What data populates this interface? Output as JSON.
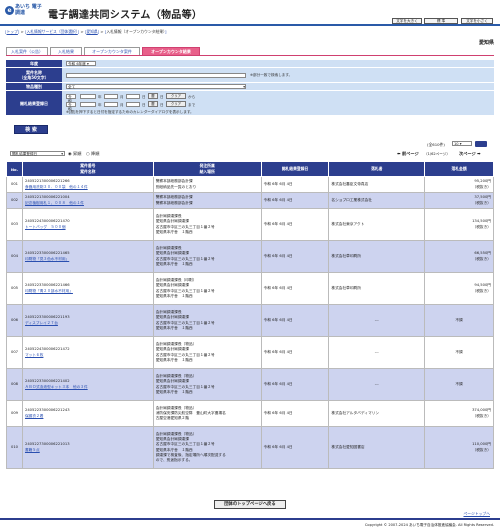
{
  "header": {
    "logo_mark": "e",
    "logo_text": "あいち 電子調達",
    "title": "電子調達共同システム（物品等）",
    "font_buttons": [
      "文字を大きく",
      "標 準",
      "文字を小さく"
    ]
  },
  "breadcrumb": {
    "items": [
      "トップ",
      "入札情報サービス（団体選択）",
      "愛知県",
      "入札情報（オープンカウンタ結果）"
    ],
    "sep": ">",
    "open": "[",
    "close": "]"
  },
  "prefecture": "愛知県",
  "tabs": [
    "入札案件（公告）",
    "入札結果",
    "オープンカウンタ案件",
    "オープンカウンタ結果"
  ],
  "search": {
    "year_label": "年度",
    "year_value": "令和 6年度",
    "name_label": "案件名称\n（全角50文字）",
    "name_note": "※部分一致で検索します。",
    "category_label": "物品種別",
    "category_value": "全て",
    "date_label": "開札結果登録日",
    "era": "令和",
    "unit_year": "年",
    "unit_month": "月",
    "unit_day": "日",
    "calendar_label": "暦",
    "from_label": "から",
    "to_label": "まで",
    "clear_label": "クリア",
    "cal_note": "※[暦]を押下すると日付を指定するためのカレンダーダイアログを表示します。",
    "search_button": "検 索"
  },
  "list": {
    "sort_value": "開札結果登録日",
    "asc_label": "昇順",
    "desc_label": "降順",
    "total": "(全610件)",
    "per_page": "10",
    "prev": "前ページ",
    "page_info": "（1/62ページ）",
    "next": "次ページ",
    "columns": [
      "No.",
      "案件番号\n案件名称",
      "発注所属\n納入場所",
      "開札結果登録日",
      "落札者",
      "落札金額"
    ],
    "rows": [
      {
        "no": "001",
        "num": "2405221300006221266",
        "name": "食器用洗剤３０．００袋　他の１４件",
        "org": "警察本部総務部会計課",
        "place": "別紙納品先一覧のとおり",
        "date": "令和 6年 6月 4日",
        "winner": "株式会社蕃臣文帝真店",
        "amount": "95,200円",
        "tax": "（税抜き）"
      },
      {
        "no": "002",
        "num": "2405221300006221004",
        "name": "記念植樹用札１，００８　他の１件",
        "org": "警察本部総務部会計課",
        "place": "警察本部総務部会計課",
        "date": "令和 6年 6月 4日",
        "winner": "名ショプロ工業株式会社",
        "amount": "37,500円",
        "tax": "（税抜き）"
      },
      {
        "no": "003",
        "num": "2405224300006221470",
        "name": "トートバッグ　５００個",
        "org": "会計局調達課長\n愛知県会計局調達課\n名古屋市中区三の丸三丁目１番２号\n愛知県本庁舎　１階西",
        "place": "",
        "date": "令和 6年 6月 4日",
        "winner": "株式会社東京アクト",
        "amount": "134,500円",
        "tax": "（税抜き）"
      },
      {
        "no": "004",
        "num": "2405223300006221465",
        "name": "印刷物「見３色水不材用」",
        "org": "会計局調達課長\n愛知県会計局調達課\n名古屋市中区三の丸三丁目１番２号\n愛知県本庁舎　１階西",
        "place": "",
        "date": "令和 6年 6月 4日",
        "winner": "株式会社草印刷所",
        "amount": "66,550円",
        "tax": "（税抜き）"
      },
      {
        "no": "005",
        "num": "2405223300006221466",
        "name": "印刷物「青２０部水不材用」",
        "org": "会計局調達課長（印刷）\n愛知県会計局調達課\n名古屋市中区三の丸三丁目１番２号\n愛知県本庁舎　１階西",
        "place": "",
        "date": "令和 6年 6月 4日",
        "winner": "株式会社草印刷所",
        "amount": "94,500円",
        "tax": "（税抜き）"
      },
      {
        "no": "006",
        "num": "2405223300006221193",
        "name": "ディスプレイ２７台",
        "org": "会計局調達課長\n愛知県会計局調達課\n名古屋市中区三の丸三丁目１番２号\n愛知県本庁舎　１階西",
        "place": "",
        "date": "令和 6年 6月 4日",
        "winner": "---",
        "amount": "不調",
        "tax": ""
      },
      {
        "no": "007",
        "num": "2405224300006221472",
        "name": "マット６枚",
        "org": "会計局調達課長（物品）\n愛知県会計局調達課\n名古屋市中区三の丸三丁目１番２号\n愛知県本庁舎　１階西",
        "place": "",
        "date": "令和 6年 6月 4日",
        "winner": "---",
        "amount": "不調",
        "tax": ""
      },
      {
        "no": "008",
        "num": "2405223300006221402",
        "name": "ＡＢＯ式血液型キット３本　他の３件",
        "org": "会計局調達課長（物品）\n愛知県会計局調達課\n名古屋市中区三の丸三丁目１番２号\n愛知県本庁舎　１階西",
        "place": "",
        "date": "令和 6年 6月 4日",
        "winner": "---",
        "amount": "不調",
        "tax": ""
      },
      {
        "no": "009",
        "num": "2405223300006221243",
        "name": "保護衣２着",
        "org": "会計局調達課長（物品）\n消防保安課防災航空隊　豊山町大字豊場名\n古屋空港愛知県２階",
        "place": "",
        "date": "令和 6年 6月 4日",
        "winner": "株式会社アルタバディマリン",
        "amount": "374,000円",
        "tax": "（税抜き）"
      },
      {
        "no": "010",
        "num": "2405227300006221013",
        "name": "書籍５点",
        "org": "会計局調達課長（物品）\n愛知県会計局調達課\n名古屋市中区三の丸三丁目１番２号\n愛知県本庁舎　１階西\n調達課で検査後、指定場所へ順次配送する\nので、別途指示する。",
        "place": "",
        "date": "令和 6年 6月 4日",
        "winner": "株式会社愛知図書店",
        "amount": "110,000円",
        "tax": "（税抜き）"
      }
    ]
  },
  "top_button": "団体のトップページへ戻る",
  "page_top": "ページトップへ",
  "copyright": "Copyright © 2007-2024 あいち電子自治体推進協議会. All Rights Reserved."
}
